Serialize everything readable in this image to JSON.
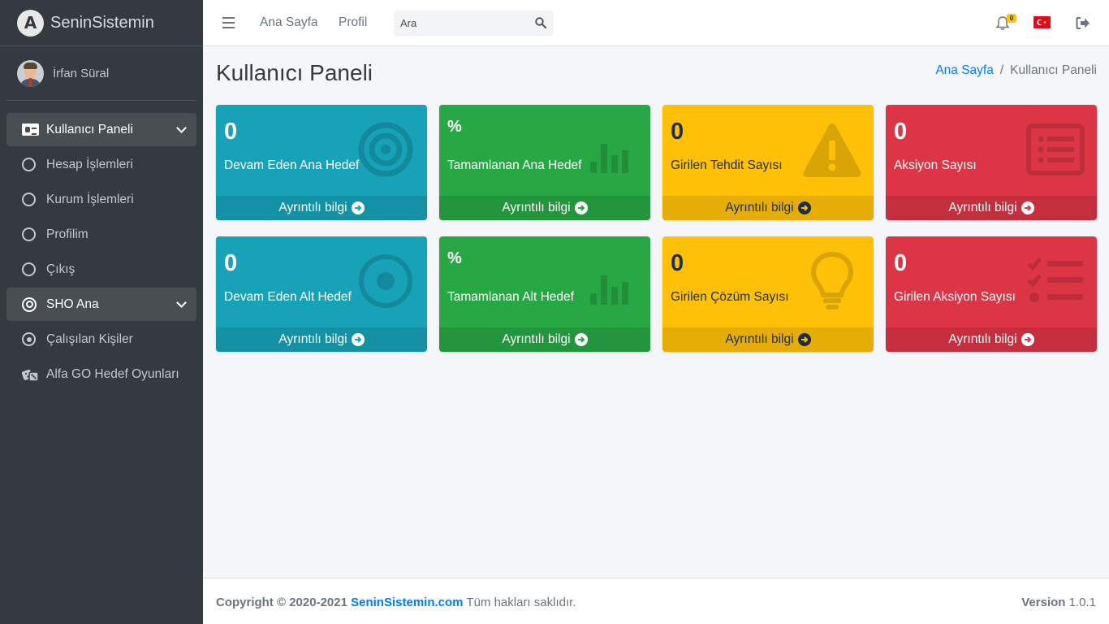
{
  "brand": {
    "logo_letter": "A",
    "name": "SeninSistemin"
  },
  "user": {
    "name": "İrfan Süral"
  },
  "sidebar": {
    "items": [
      {
        "label": "Kullanıcı Paneli",
        "icon": "id-card-icon",
        "active": true
      },
      {
        "label": "Hesap İşlemleri",
        "icon": "circle-icon"
      },
      {
        "label": "Kurum İşlemleri",
        "icon": "circle-icon"
      },
      {
        "label": "Profilim",
        "icon": "circle-icon"
      },
      {
        "label": "Çıkış",
        "icon": "circle-icon"
      },
      {
        "label": "SHO Ana",
        "icon": "target-icon",
        "active": true
      },
      {
        "label": "Çalışılan Kişiler",
        "icon": "dot-circle-icon"
      },
      {
        "label": "Alfa GO Hedef Oyunları",
        "icon": "dice-icon"
      }
    ]
  },
  "topbar": {
    "links": [
      "Ana Sayfa",
      "Profil"
    ],
    "search_placeholder": "Ara",
    "notification_count": "0",
    "language": "Türkçe"
  },
  "page": {
    "title": "Kullanıcı Paneli",
    "breadcrumb": [
      "Ana Sayfa",
      "Kullanıcı Paneli"
    ]
  },
  "boxes": [
    {
      "value": "0",
      "label": "Devam Eden Ana Hedef",
      "footer": "Ayrıntılı bilgi",
      "icon": "bullseye-icon",
      "color": "#17a2b8"
    },
    {
      "value": "%",
      "label": "Tamamlanan Ana Hedef",
      "footer": "Ayrıntılı bilgi",
      "icon": "bar-chart-icon",
      "color": "#28a745"
    },
    {
      "value": "0",
      "label": "Girilen Tehdit Sayısı",
      "footer": "Ayrıntılı bilgi",
      "icon": "warning-icon",
      "color": "#ffc107"
    },
    {
      "value": "0",
      "label": "Aksiyon Sayısı",
      "footer": "Ayrıntılı bilgi",
      "icon": "list-alt-icon",
      "color": "#dc3545"
    },
    {
      "value": "0",
      "label": "Devam Eden Alt Hedef",
      "footer": "Ayrıntılı bilgi",
      "icon": "dot-circle-icon",
      "color": "#17a2b8"
    },
    {
      "value": "%",
      "label": "Tamamlanan Alt Hedef",
      "footer": "Ayrıntılı bilgi",
      "icon": "bar-chart-icon",
      "color": "#28a745"
    },
    {
      "value": "0",
      "label": "Girilen Çözüm Sayısı",
      "footer": "Ayrıntılı bilgi",
      "icon": "lightbulb-icon",
      "color": "#ffc107"
    },
    {
      "value": "0",
      "label": "Girilen Aksiyon Sayısı",
      "footer": "Ayrıntılı bilgi",
      "icon": "tasks-icon",
      "color": "#dc3545"
    }
  ],
  "footer": {
    "copyright_prefix": "Copyright © 2020-2021",
    "site": "SeninSistemin.com",
    "rights": "Tüm hakları saklıdır.",
    "version_label": "Version",
    "version": "1.0.1"
  }
}
